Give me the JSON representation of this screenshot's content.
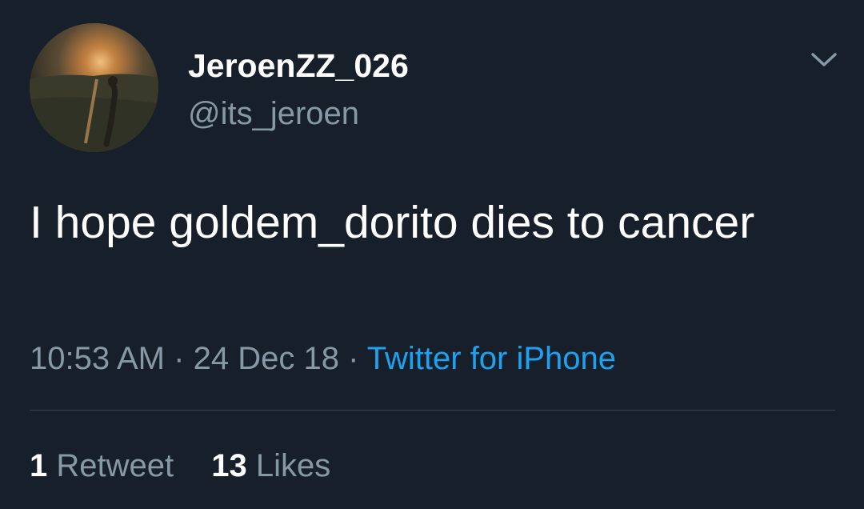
{
  "user": {
    "display_name": "JeroenZZ_026",
    "handle": "@its_jeroen"
  },
  "tweet": {
    "text": "I hope goldem_dorito dies to cancer",
    "time": "10:53 AM",
    "separator": "·",
    "date": "24 Dec 18",
    "source": "Twitter for iPhone"
  },
  "stats": {
    "retweets_count": "1",
    "retweets_label": "Retweet",
    "likes_count": "13",
    "likes_label": "Likes"
  },
  "icons": {
    "menu": "chevron-down-icon",
    "avatar": "avatar"
  },
  "colors": {
    "background": "#161f2a",
    "primary_text": "#ffffff",
    "secondary_text": "#8899a6",
    "link": "#1da1f2",
    "divider": "#38444d"
  }
}
